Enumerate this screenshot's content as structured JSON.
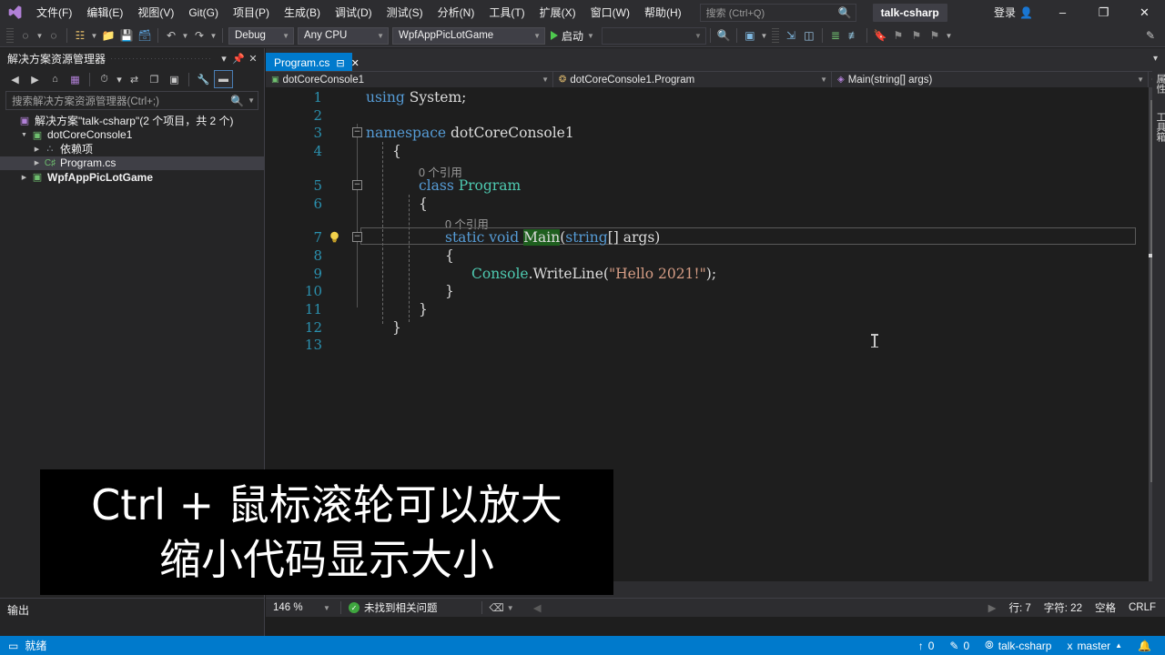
{
  "titlebar": {
    "logo_icon": "visual-studio-logo-icon",
    "menus": [
      {
        "label": "文件(F)"
      },
      {
        "label": "编辑(E)"
      },
      {
        "label": "视图(V)"
      },
      {
        "label": "Git(G)"
      },
      {
        "label": "项目(P)"
      },
      {
        "label": "生成(B)"
      },
      {
        "label": "调试(D)"
      },
      {
        "label": "测试(S)"
      },
      {
        "label": "分析(N)"
      },
      {
        "label": "工具(T)"
      },
      {
        "label": "扩展(X)"
      },
      {
        "label": "窗口(W)"
      },
      {
        "label": "帮助(H)"
      }
    ],
    "search_placeholder": "搜索 (Ctrl+Q)",
    "search_icon": "search-icon",
    "project_chip": "talk-csharp",
    "signin_label": "登录",
    "signin_icon": "account-add-icon",
    "minimize_icon": "minimize-icon",
    "restore_icon": "restore-icon",
    "close_icon": "close-icon"
  },
  "toolbar": {
    "back_icon": "navigate-back-icon",
    "forward_icon": "navigate-forward-icon",
    "new_project_icon": "new-project-icon",
    "open_icon": "open-file-icon",
    "save_icon": "save-icon",
    "save_all_icon": "save-all-icon",
    "undo_icon": "undo-icon",
    "redo_icon": "redo-icon",
    "configuration": "Debug",
    "platform": "Any CPU",
    "startup_project": "WpfAppPicLotGame",
    "run_label": "启动",
    "run_icon": "play-icon",
    "find_icon": "find-in-files-icon",
    "screenshot_icon": "attach-snapshot-icon",
    "step_icon": "step-into-icon",
    "compare_icon": "compare-icon",
    "indent_icon": "indent-icon",
    "outdent_icon": "outdent-icon",
    "bookmark_icon": "bookmark-icon",
    "next_bookmark_icon": "next-bookmark-icon",
    "prev_bookmark_icon": "previous-bookmark-icon",
    "clear_bookmark_icon": "clear-bookmarks-icon",
    "overflow_icon": "toolbar-overflow-icon",
    "feedback_icon": "feedback-icon"
  },
  "solution_explorer": {
    "title": "解决方案资源管理器",
    "header_buttons": [
      {
        "name": "dropdown-icon",
        "glyph": "▾"
      },
      {
        "name": "pin-icon",
        "glyph": "⚲"
      },
      {
        "name": "close-icon",
        "glyph": "✕"
      }
    ],
    "toolbar_icons": [
      {
        "name": "back-icon",
        "glyph": "◐"
      },
      {
        "name": "forward-icon",
        "glyph": "◑"
      },
      {
        "name": "home-icon",
        "glyph": "⌂"
      },
      {
        "name": "pending-changes-icon",
        "glyph": "▤"
      },
      {
        "name": "history-icon",
        "glyph": "◷"
      },
      {
        "name": "sync-icon",
        "glyph": "⇄"
      },
      {
        "name": "collapse-all-icon",
        "glyph": "⧉"
      },
      {
        "name": "show-all-files-icon",
        "glyph": "▣"
      },
      {
        "name": "properties-icon",
        "glyph": "🔧"
      },
      {
        "name": "preview-icon",
        "glyph": "▬"
      }
    ],
    "search_placeholder": "搜索解决方案资源管理器(Ctrl+;)",
    "search_icon": "search-icon",
    "tree": [
      {
        "label": "解决方案\"talk-csharp\"(2 个项目，共 2 个)",
        "icon": "solution-icon",
        "indent": 0,
        "twisty": "",
        "bold": false,
        "selected": false
      },
      {
        "label": "dotCoreConsole1",
        "icon": "csharp-project-icon",
        "indent": 1,
        "twisty": "▾",
        "bold": false,
        "selected": false
      },
      {
        "label": "依赖项",
        "icon": "dependencies-icon",
        "indent": 2,
        "twisty": "▸",
        "bold": false,
        "selected": false
      },
      {
        "label": "Program.cs",
        "icon": "csharp-file-icon",
        "indent": 2,
        "twisty": "▸",
        "bold": false,
        "selected": true
      },
      {
        "label": "WpfAppPicLotGame",
        "icon": "csharp-project-icon",
        "indent": 1,
        "twisty": "▸",
        "bold": true,
        "selected": false
      }
    ]
  },
  "editor": {
    "tab": {
      "name": "Program.cs",
      "pin_icon": "pin-icon",
      "close_icon": "close-icon"
    },
    "navbar": {
      "project": "dotCoreConsole1",
      "project_icon": "csharp-project-icon",
      "type": "dotCoreConsole1.Program",
      "type_icon": "class-icon",
      "member": "Main(string[] args)",
      "member_icon": "method-private-icon",
      "expand_icon": "expand-editor-icon"
    },
    "lines": [
      {
        "n": "1",
        "indent": 0,
        "parts": [
          {
            "t": "using ",
            "c": "kw"
          },
          {
            "t": "System;",
            "c": "pln"
          }
        ]
      },
      {
        "n": "2",
        "indent": 0,
        "parts": []
      },
      {
        "n": "3",
        "indent": 0,
        "glyph": "−",
        "parts": [
          {
            "t": "namespace ",
            "c": "kw"
          },
          {
            "t": "dotCoreConsole1",
            "c": "pln"
          }
        ]
      },
      {
        "n": "4",
        "indent": 1,
        "parts": [
          {
            "t": "{",
            "c": "pln"
          }
        ]
      },
      {
        "n": "",
        "indent": 2,
        "lens": "0 个引用"
      },
      {
        "n": "5",
        "indent": 2,
        "glyph": "−",
        "parts": [
          {
            "t": "class ",
            "c": "kw"
          },
          {
            "t": "Program",
            "c": "typ"
          }
        ]
      },
      {
        "n": "6",
        "indent": 2,
        "parts": [
          {
            "t": "{",
            "c": "pln"
          }
        ]
      },
      {
        "n": "",
        "indent": 3,
        "lens": "0 个引用"
      },
      {
        "n": "7",
        "indent": 3,
        "glyph": "−",
        "bulb": true,
        "current": true,
        "parts": [
          {
            "t": "static void ",
            "c": "kw"
          },
          {
            "t": "Main",
            "c": "hl-main"
          },
          {
            "t": "(",
            "c": "pln"
          },
          {
            "t": "string",
            "c": "kw"
          },
          {
            "t": "[] args)",
            "c": "pln"
          }
        ]
      },
      {
        "n": "8",
        "indent": 3,
        "parts": [
          {
            "t": "{",
            "c": "pln"
          }
        ]
      },
      {
        "n": "9",
        "indent": 4,
        "parts": [
          {
            "t": "Console",
            "c": "typ"
          },
          {
            "t": ".WriteLine(",
            "c": "pln"
          },
          {
            "t": "\"Hello 2021!\"",
            "c": "str"
          },
          {
            "t": ");",
            "c": "pln"
          }
        ]
      },
      {
        "n": "10",
        "indent": 3,
        "parts": [
          {
            "t": "}",
            "c": "pln"
          }
        ]
      },
      {
        "n": "11",
        "indent": 2,
        "parts": [
          {
            "t": "}",
            "c": "pln"
          }
        ]
      },
      {
        "n": "12",
        "indent": 1,
        "parts": [
          {
            "t": "}",
            "c": "pln"
          }
        ]
      },
      {
        "n": "13",
        "indent": 0,
        "parts": []
      }
    ],
    "status": {
      "zoom": "146 %",
      "zoom_caret_icon": "chevron-down-icon",
      "issues_icon": "check-circle-icon",
      "issues_text": "未找到相关问题",
      "filter_icon": "issue-filter-icon",
      "line": "行: 7",
      "column": "字符: 22",
      "whitespace": "空格",
      "eol": "CRLF"
    }
  },
  "output_pane": {
    "title": "输出"
  },
  "statusbar": {
    "ready_icon": "ready-icon",
    "ready_text": "就绪",
    "publish_icon": "up-arrow-icon",
    "publish_count": "0",
    "edit_icon": "pencil-icon",
    "edit_count": "0",
    "repo_icon": "source-control-icon",
    "repo_name": "talk-csharp",
    "branch_icon": "branch-icon",
    "branch_name": "master",
    "branch_caret_icon": "chevron-up-icon",
    "notification_icon": "bell-icon"
  },
  "right_tabs": [
    {
      "label": "属性"
    },
    {
      "label": "工具箱"
    }
  ],
  "caption_overlay": {
    "line1": "Ctrl + 鼠标滚轮可以放大",
    "line2": "缩小代码显示大小"
  },
  "colors": {
    "accent": "#007acc",
    "chrome": "#2d2d30",
    "panel": "#252526",
    "editor_bg": "#1e1e1e",
    "keyword": "#569cd6",
    "type": "#4ec9b0",
    "string": "#d69d85",
    "linenum": "#2b91af",
    "highlight": "#1e5f1e"
  }
}
